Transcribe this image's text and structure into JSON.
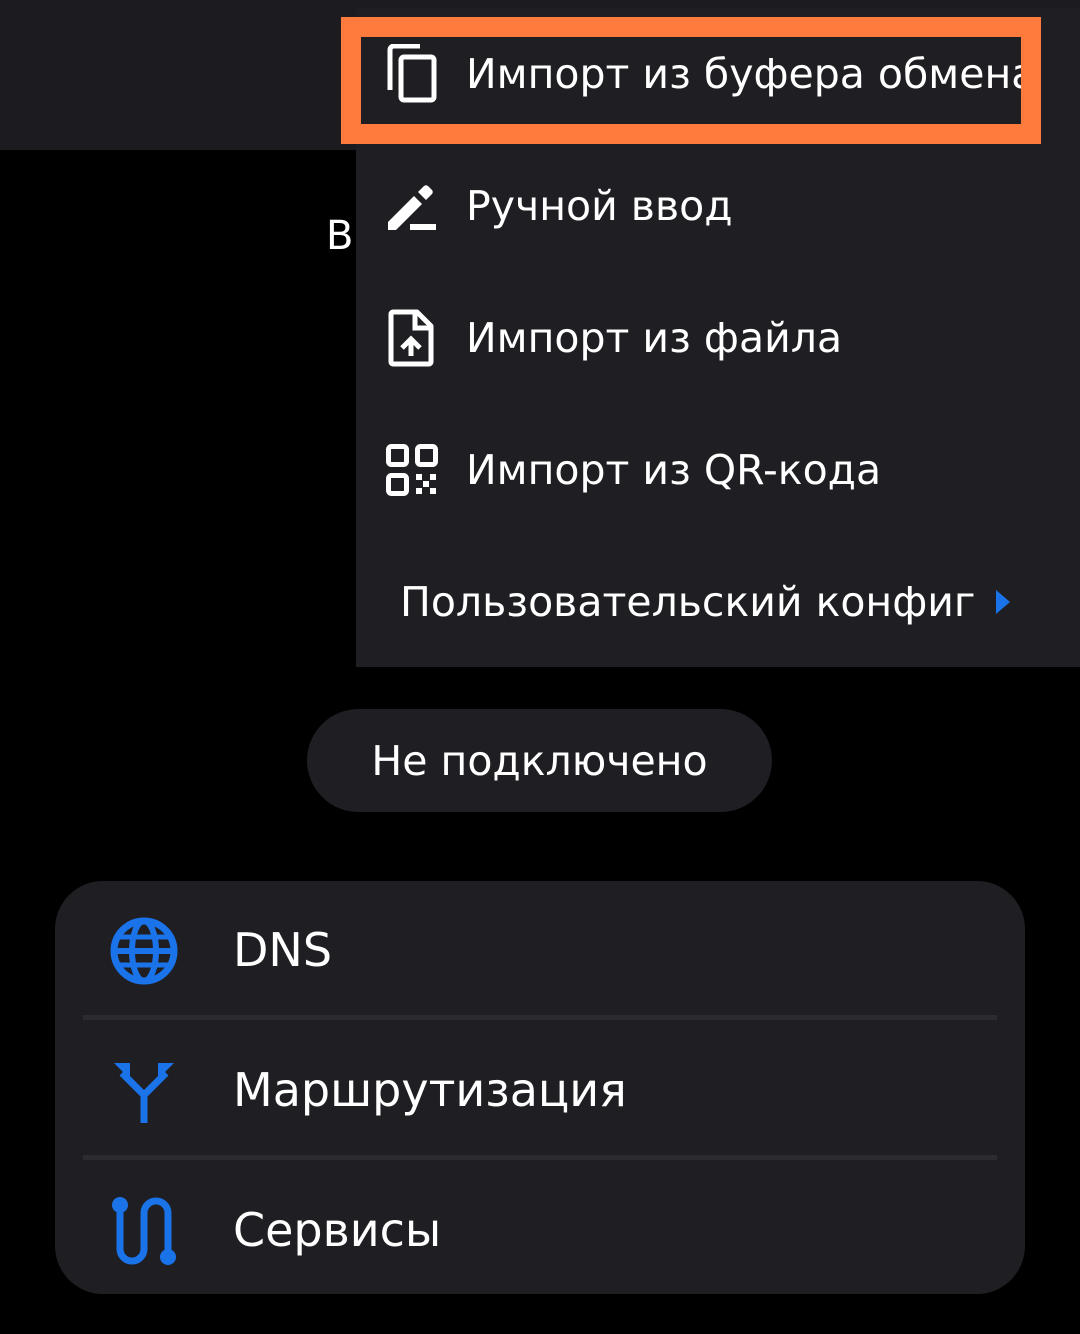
{
  "background_partial_text": "В",
  "menu": {
    "items": [
      {
        "label": "Импорт из буфера обмена",
        "icon": "copy-icon"
      },
      {
        "label": "Ручной ввод",
        "icon": "edit-pen-icon"
      },
      {
        "label": "Импорт из файла",
        "icon": "file-upload-icon"
      },
      {
        "label": "Импорт из QR-кода",
        "icon": "qr-code-icon"
      },
      {
        "label": "Пользовательский конфиг",
        "icon": "chevron-right-icon"
      }
    ]
  },
  "status": {
    "label": "Не подключено"
  },
  "settings": {
    "rows": [
      {
        "label": "DNS",
        "icon": "globe-icon"
      },
      {
        "label": "Маршрутизация",
        "icon": "routing-icon"
      },
      {
        "label": "Сервисы",
        "icon": "services-icon"
      }
    ]
  },
  "colors": {
    "highlight": "#ff7a3d",
    "accent": "#1a73e8",
    "surface": "#1f1e22",
    "background": "#000000"
  }
}
